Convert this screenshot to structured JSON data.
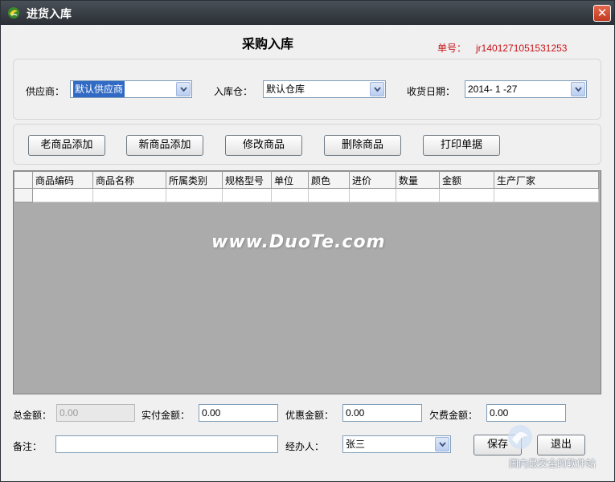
{
  "window": {
    "title": "进货入库",
    "close_glyph": "✕"
  },
  "form": {
    "heading": "采购入库",
    "order_no_label": "单号：",
    "order_no_value": "jr1401271051531253"
  },
  "filters": {
    "supplier_label": "供应商：",
    "supplier_value": "默认供应商",
    "warehouse_label": "入库仓：",
    "warehouse_value": "默认仓库",
    "date_label": "收货日期：",
    "date_value": "2014- 1 -27"
  },
  "toolbar": {
    "add_old": "老商品添加",
    "add_new": "新商品添加",
    "edit": "修改商品",
    "delete": "删除商品",
    "print": "打印单据"
  },
  "grid": {
    "columns": [
      "商品编码",
      "商品名称",
      "所属类别",
      "规格型号",
      "单位",
      "颜色",
      "进价",
      "数量",
      "金额",
      "生产厂家"
    ]
  },
  "watermark": "www.DuoTe.com",
  "totals": {
    "total_label": "总金额：",
    "total_value": "0.00",
    "paid_label": "实付金额：",
    "paid_value": "0.00",
    "discount_label": "优惠金额：",
    "discount_value": "0.00",
    "owed_label": "欠费金额：",
    "owed_value": "0.00"
  },
  "footer": {
    "remark_label": "备注：",
    "remark_value": "",
    "handler_label": "经办人：",
    "handler_value": "张三",
    "save": "保存",
    "exit": "退出"
  },
  "branding": {
    "logo_text": "国内最安全的软件站"
  },
  "icons": {
    "app": "app-logo-icon",
    "close": "close-icon",
    "dropdown": "chevron-down-icon"
  },
  "colors": {
    "order_no": "#c8141a",
    "titlebar": "#2a2f35",
    "close_button": "#c13a1f",
    "selection": "#316ac5"
  }
}
